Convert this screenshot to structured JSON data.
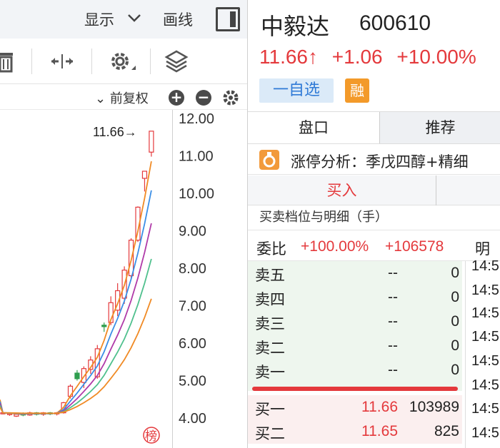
{
  "chart_toolbar": {
    "display_label": "显示",
    "draw_label": "画线",
    "adjust_label": "前复权"
  },
  "chart_data": {
    "type": "candlestick",
    "y_ticks": [
      "12.00",
      "11.00",
      "10.00",
      "9.00",
      "8.00",
      "7.00",
      "6.00",
      "5.00",
      "4.00"
    ],
    "ylim": [
      3.75,
      12.25
    ],
    "last_price_label": "11.66→",
    "series": [
      {
        "open": 4.12,
        "close": 4.14,
        "high": 4.16,
        "low": 4.1
      },
      {
        "open": 4.1,
        "close": 4.12,
        "high": 4.15,
        "low": 4.06
      },
      {
        "open": 4.05,
        "close": 4.1,
        "high": 4.13,
        "low": 4.03
      },
      {
        "open": 4.12,
        "close": 4.08,
        "high": 4.15,
        "low": 4.05
      },
      {
        "open": 4.08,
        "close": 4.14,
        "high": 4.17,
        "low": 4.06
      },
      {
        "open": 4.14,
        "close": 4.1,
        "high": 4.16,
        "low": 4.07
      },
      {
        "open": 4.1,
        "close": 4.14,
        "high": 4.16,
        "low": 4.06
      },
      {
        "open": 4.14,
        "close": 4.11,
        "high": 4.16,
        "low": 4.08
      },
      {
        "open": 4.11,
        "close": 4.14,
        "high": 4.16,
        "low": 4.07
      },
      {
        "open": 4.14,
        "close": 4.41,
        "high": 4.43,
        "low": 4.12
      },
      {
        "open": 4.58,
        "close": 4.85,
        "high": 4.9,
        "low": 4.52
      },
      {
        "open": 5.2,
        "close": 5.05,
        "high": 5.28,
        "low": 5.0
      },
      {
        "open": 4.95,
        "close": 5.32,
        "high": 5.38,
        "low": 4.8
      },
      {
        "open": 5.3,
        "close": 5.55,
        "high": 5.65,
        "low": 5.18
      },
      {
        "open": 5.1,
        "close": 5.85,
        "high": 5.95,
        "low": 5.05
      },
      {
        "open": 6.48,
        "close": 6.44,
        "high": 6.55,
        "low": 6.3
      },
      {
        "open": 6.55,
        "close": 7.08,
        "high": 7.25,
        "low": 6.48
      },
      {
        "open": 6.88,
        "close": 7.4,
        "high": 7.6,
        "low": 6.72
      },
      {
        "open": 7.2,
        "close": 7.95,
        "high": 8.05,
        "low": 7.05
      },
      {
        "open": 7.8,
        "close": 8.75,
        "high": 8.8,
        "low": 7.7
      },
      {
        "open": 8.75,
        "close": 9.63,
        "high": 9.65,
        "low": 8.7
      },
      {
        "open": 10.4,
        "close": 10.59,
        "high": 10.6,
        "low": 10.05
      },
      {
        "open": 11.1,
        "close": 11.66,
        "high": 11.66,
        "low": 10.98
      }
    ],
    "ma_colors": [
      "#f08a24",
      "#3a8ee6",
      "#b03aa8",
      "#4fc08d",
      "#f08a24"
    ],
    "up_color": "#e4393c",
    "down_color": "#2e9e4e",
    "badge": "榜"
  },
  "quote": {
    "name": "中毅达",
    "code": "600610",
    "price": "11.66↑",
    "change": "+1.06",
    "change_pct": "+10.00%",
    "watch_button": "一自选",
    "margin_badge": "融"
  },
  "tabs": [
    "盘口",
    "推荐"
  ],
  "analysis_text": "涨停分析：季戊四醇+精细",
  "buy_label": "买入",
  "detail_title": "买卖档位与明细（手）",
  "ratio": {
    "label": "委比",
    "pct": "+100.00%",
    "diff": "+106578",
    "right_label": "明细"
  },
  "asks": [
    {
      "name": "卖五",
      "price": "--",
      "qty": "0"
    },
    {
      "name": "卖四",
      "price": "--",
      "qty": "0"
    },
    {
      "name": "卖三",
      "price": "--",
      "qty": "0"
    },
    {
      "name": "卖二",
      "price": "--",
      "qty": "0"
    },
    {
      "name": "卖一",
      "price": "--",
      "qty": "0"
    }
  ],
  "bids": [
    {
      "name": "买一",
      "price": "11.66",
      "qty": "103989"
    },
    {
      "name": "买二",
      "price": "11.65",
      "qty": "825"
    }
  ],
  "ticks": [
    "14:5",
    "14:5",
    "14:5",
    "14:5",
    "14:5",
    "14:5",
    "14:5",
    "14:5"
  ],
  "colors": {
    "up": "#e4393c",
    "accent": "#2f7ad6",
    "orange": "#f39a2a"
  }
}
